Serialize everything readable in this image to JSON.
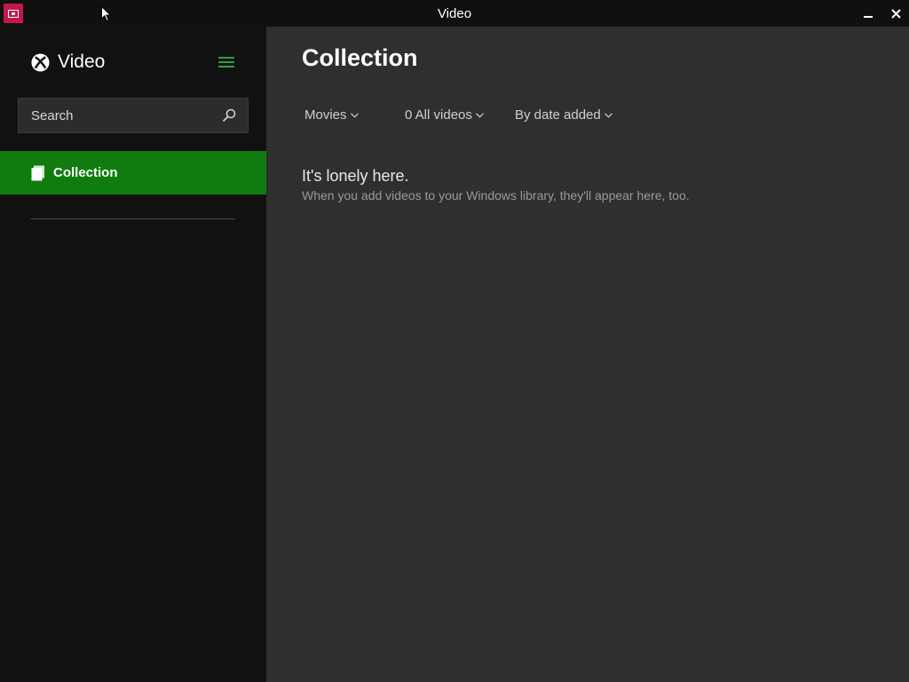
{
  "window": {
    "title": "Video"
  },
  "sidebar": {
    "brand": "Video",
    "search": {
      "placeholder": "Search",
      "value": ""
    },
    "nav": [
      {
        "label": "Collection",
        "icon": "collection-icon",
        "selected": true
      }
    ]
  },
  "main": {
    "title": "Collection",
    "filters": {
      "type": "Movies",
      "count_filter": "0 All videos",
      "sort": "By date added"
    },
    "empty": {
      "heading": "It's lonely here.",
      "message": "When you add videos to your Windows library, they'll appear here, too."
    }
  },
  "colors": {
    "accent": "#107c10",
    "app_icon": "#c2184a",
    "hamburger": "#2ea043"
  }
}
